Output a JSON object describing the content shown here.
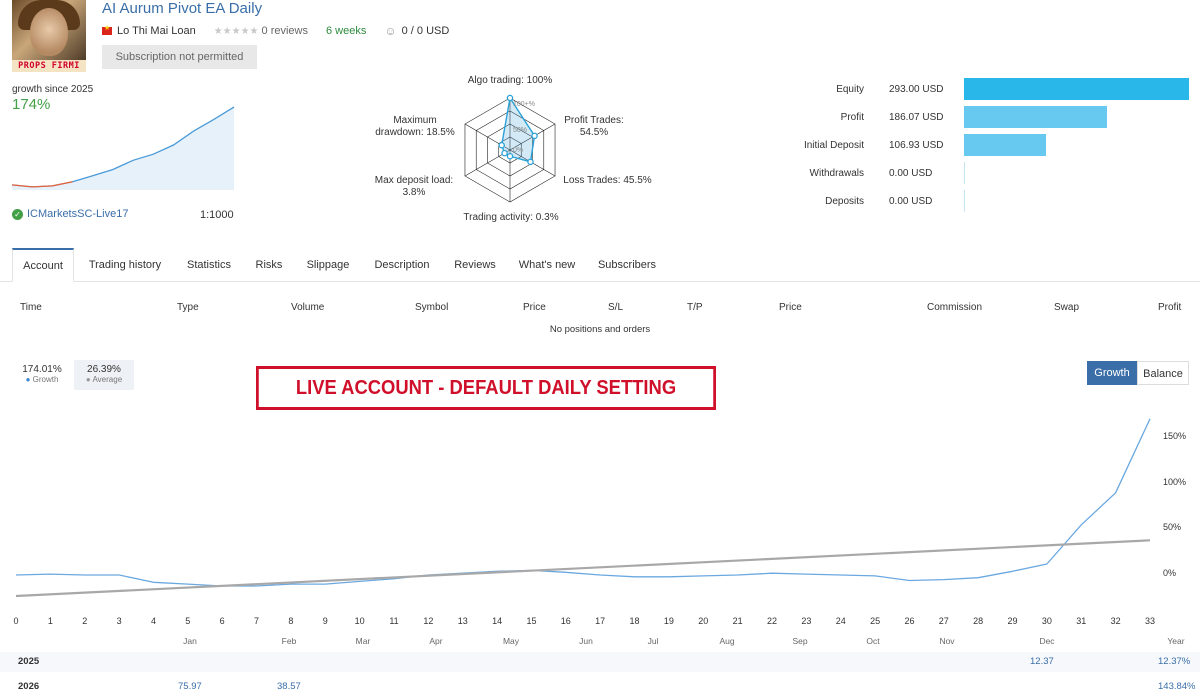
{
  "header": {
    "logo_text": "PROPS FIRMI",
    "title": "AI Aurum Pivot EA Daily",
    "author": "Lo Thi Mai Loan",
    "reviews": "0 reviews",
    "weeks": "6 weeks",
    "price_usd": "0 / 0 USD",
    "subscription_button": "Subscription not permitted"
  },
  "summary": {
    "growth_label": "growth since 2025",
    "growth_value": "174%",
    "broker": "ICMarketsSC-Live17",
    "leverage": "1:1000",
    "mini_chart": [
      0,
      -0.4,
      -0.2,
      0.6,
      1.8,
      3.0,
      4.8,
      6.0,
      7.8,
      10.5,
      12.8,
      15.2
    ]
  },
  "radar": {
    "algo_trading": "Algo trading: 100%",
    "profit_trades": "Profit Trades:",
    "profit_trades_val": "54.5%",
    "loss_trades": "Loss Trades: 45.5%",
    "trading_activity": "Trading activity: 0.3%",
    "max_deposit_load": "Max deposit load:",
    "max_deposit_load_val": "3.8%",
    "max_drawdown": "Maximum",
    "max_drawdown_val": "drawdown: 18.5%",
    "ring_100": "100+%",
    "ring_50": "50%",
    "ring_0": "0%",
    "values": [
      1.0,
      0.545,
      0.455,
      0.003,
      0.038,
      0.185
    ]
  },
  "financials": {
    "max": 293,
    "colors": [
      "#29b6e8",
      "#67c8f0",
      "#67c8f0",
      "#c9e6f5",
      "#c9e6f5"
    ],
    "rows": [
      {
        "label": "Equity",
        "value": "293.00 USD",
        "num": 293
      },
      {
        "label": "Profit",
        "value": "186.07 USD",
        "num": 186.07
      },
      {
        "label": "Initial Deposit",
        "value": "106.93 USD",
        "num": 106.93
      },
      {
        "label": "Withdrawals",
        "value": "0.00 USD",
        "num": 0
      },
      {
        "label": "Deposits",
        "value": "0.00 USD",
        "num": 0
      }
    ]
  },
  "tabs": [
    "Account",
    "Trading history",
    "Statistics",
    "Risks",
    "Slippage",
    "Description",
    "Reviews",
    "What's new",
    "Subscribers"
  ],
  "table": {
    "columns": [
      "Time",
      "Type",
      "Volume",
      "Symbol",
      "Price",
      "S/L",
      "T/P",
      "Price",
      "Commission",
      "Swap",
      "Profit"
    ],
    "empty_text": "No positions and orders"
  },
  "stats": {
    "growth_value": "174.01%",
    "growth_label": "Growth",
    "average_value": "26.39%",
    "average_label": "Average",
    "bullet": "●"
  },
  "banner": "LIVE ACCOUNT - DEFAULT DAILY SETTING",
  "toggle": {
    "growth": "Growth",
    "balance": "Balance"
  },
  "chart_data": {
    "type": "line",
    "x_ticks": [
      "0",
      "1",
      "2",
      "3",
      "4",
      "5",
      "6",
      "7",
      "8",
      "9",
      "10",
      "11",
      "12",
      "13",
      "14",
      "15",
      "16",
      "17",
      "18",
      "19",
      "20",
      "21",
      "22",
      "23",
      "24",
      "25",
      "26",
      "27",
      "28",
      "29",
      "30",
      "31",
      "32",
      "33"
    ],
    "month_labels": [
      "Jan",
      "Feb",
      "Mar",
      "Apr",
      "May",
      "Jun",
      "Jul",
      "Aug",
      "Sep",
      "Oct",
      "Nov",
      "Dec",
      "Year"
    ],
    "y_ticks": [
      "150%",
      "100%",
      "50%",
      "0%"
    ],
    "ylim": [
      -25,
      175
    ],
    "xlim": [
      0,
      33
    ],
    "series": [
      {
        "values": [
          [
            0,
            0
          ],
          [
            1,
            1
          ],
          [
            2,
            0
          ],
          [
            3,
            0
          ],
          [
            4,
            -8
          ],
          [
            5,
            -10
          ],
          [
            6,
            -12
          ],
          [
            7,
            -12
          ],
          [
            8,
            -10
          ],
          [
            9,
            -10
          ],
          [
            10,
            -7
          ],
          [
            11,
            -4
          ],
          [
            12,
            0
          ],
          [
            13,
            2
          ],
          [
            14,
            4
          ],
          [
            15,
            5
          ],
          [
            16,
            3
          ],
          [
            17,
            0
          ],
          [
            18,
            -2
          ],
          [
            19,
            -2
          ],
          [
            20,
            -1
          ],
          [
            21,
            0
          ],
          [
            22,
            2
          ],
          [
            23,
            1
          ],
          [
            24,
            0
          ],
          [
            25,
            -1
          ],
          [
            26,
            -6
          ],
          [
            27,
            -5
          ],
          [
            28,
            -3
          ],
          [
            29,
            4
          ],
          [
            30,
            12
          ],
          [
            31,
            55
          ],
          [
            32,
            90
          ],
          [
            33,
            171
          ]
        ]
      },
      {
        "values": [
          [
            0,
            -23
          ],
          [
            33,
            38
          ]
        ]
      }
    ],
    "grid": false
  },
  "yearly": {
    "rows": [
      {
        "year": "2025",
        "values": [
          {
            "col": "Dec",
            "v": "12.37"
          },
          {
            "col": "Year",
            "v": "12.37%"
          }
        ]
      },
      {
        "year": "2026",
        "values": [
          {
            "col": "Jan",
            "v": "75.97"
          },
          {
            "col": "Feb",
            "v": "38.57"
          },
          {
            "col": "Year",
            "v": "143.84%"
          }
        ]
      }
    ]
  }
}
